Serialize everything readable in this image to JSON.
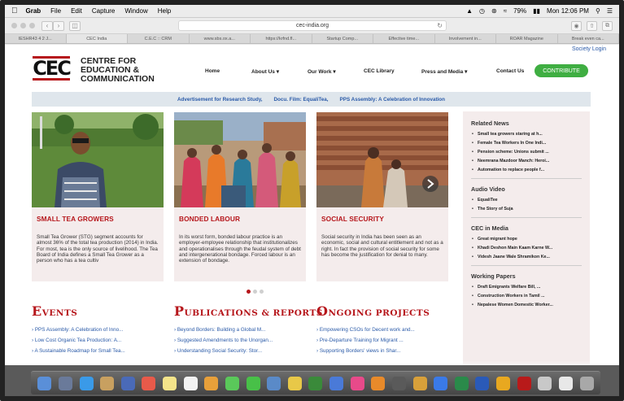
{
  "menubar": {
    "app": "Grab",
    "items": [
      "File",
      "Edit",
      "Capture",
      "Window",
      "Help"
    ],
    "battery": "79%",
    "clock": "Mon 12:06 PM"
  },
  "browser": {
    "url": "cec-india.org",
    "tabs": [
      "IESHR43 4 2 J...",
      "CEC India",
      "C.E.C :: CRM",
      "www.sbs.ox.a...",
      "https://krfnd.fl...",
      "Startup Comp...",
      "Effective time...",
      "Involvement in...",
      "ROAR Magazine",
      "Break even ca..."
    ]
  },
  "site": {
    "society_login": "Society Login",
    "logo_text": "CEC",
    "org_name": [
      "CENTRE FOR",
      "EDUCATION &",
      "COMMUNICATION"
    ],
    "nav": [
      {
        "label": "Home"
      },
      {
        "label": "About Us",
        "arrow": "▾"
      },
      {
        "label": "Our Work",
        "arrow": "▾"
      },
      {
        "label": "CEC Library"
      },
      {
        "label": "Press and Media",
        "arrow": "▾"
      },
      {
        "label": "Contact Us"
      }
    ],
    "contribute": "CONTRIBUTE",
    "announcements": [
      "Advertisement for Research Study,",
      "Docu. Film: EqualiTea,",
      "PPS Assembly: A Celebration of Innovation"
    ],
    "cards": [
      {
        "title": "SMALL TEA GROWERS",
        "text": "Small Tea Grower (STG) segment accounts for almost 36% of the total tea production (2014) in India. For most, tea is the only source of livelihood. The Tea Board of India defines a Small Tea Grower as a person who has a tea cultiv"
      },
      {
        "title": "BONDED LABOUR",
        "text": "In its worst form, bonded labour practice is an employer-employee relationship that institutionalizes and operationalises through the feudal system of debt and intergenerational bondage. Forced labour is an extension of bondage."
      },
      {
        "title": "SOCIAL SECURITY",
        "text": "Social security in India has been seen as an economic, social and cultural entitlement and not as a right. In fact the provision of social security for some has become the justification for denial to many."
      }
    ],
    "events": {
      "title_first": "E",
      "title_rest": "VENTS",
      "items": [
        "PPS Assembly: A Celebration of Inno...",
        "Low Cost Organic Tea Production: A...",
        "A Sustainable Roadmap for Small Tea..."
      ]
    },
    "publications": {
      "title_first": "P",
      "title_rest": "UBLICATIONS & REPORTS",
      "items": [
        "Beyond Borders: Building a Global M...",
        "Suggested Amendments to the Unorgan...",
        "Understanding Social Security: Stor..."
      ]
    },
    "projects": {
      "title_first": "O",
      "title_rest": "NGOING PROJECTS",
      "items": [
        "Empowering CSOs for Decent work and...",
        "Pre-Departure Training for Migrant ...",
        "Supporting Borders' views in Shar..."
      ]
    },
    "sidebar": [
      {
        "title": "Related News",
        "items": [
          "Small tea growers staring at h...",
          "Female Tea Workers In One Indi...",
          "Pension scheme: Unions submit ...",
          "Neemrana Mazdoor Manch: Heroi...",
          "Automation to replace people f..."
        ]
      },
      {
        "title": "Audio Video",
        "items": [
          "EqualiTee",
          "The Story of Suja"
        ]
      },
      {
        "title": "CEC in Media",
        "items": [
          "Great migrant hope",
          "Khadi Deshon Main Kaam Karne W...",
          "Videsh Jaane Wale Shramikon Ke..."
        ]
      },
      {
        "title": "Working Papers",
        "items": [
          "Draft Emigrants Welfare Bill, ...",
          "Construction Workers in Tamil ...",
          "Nepalese Women Domestic Worker..."
        ]
      }
    ]
  },
  "colors": {
    "brand_red": "#b6161b",
    "link_blue": "#2a5aa8",
    "contribute_green": "#3fae42"
  }
}
